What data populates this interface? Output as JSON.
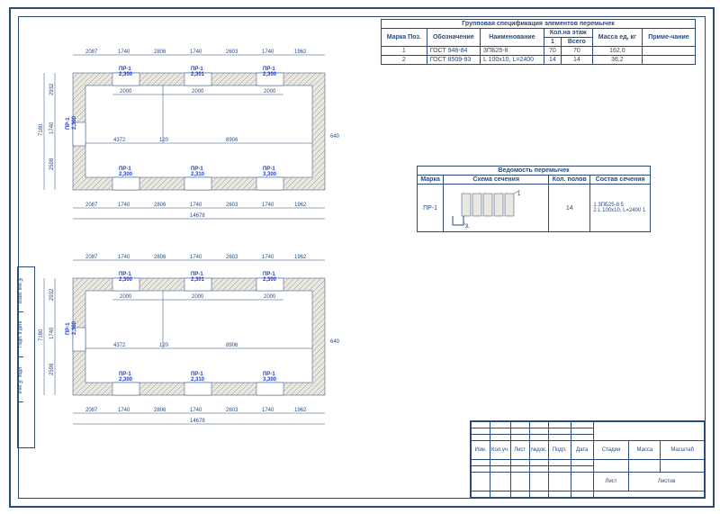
{
  "spec_table": {
    "title": "Групповая спецификация элементов перемычек",
    "headers": [
      "Марка Поз.",
      "Обозначение",
      "Наименование",
      "Кол.на этаж",
      "1",
      "Всего",
      "Масса ед, кг",
      "Приме-чание"
    ],
    "rows": [
      [
        "1",
        "ГОСТ 948-84",
        "3ПБ25-8",
        "70",
        "70",
        "162,0",
        ""
      ],
      [
        "2",
        "ГОСТ 8509-93",
        "L 100x10, L=2400",
        "14",
        "14",
        "36,2",
        ""
      ]
    ]
  },
  "lintel_table": {
    "title": "Ведомость перемычек",
    "headers": [
      "Марка",
      "Схема сечения",
      "Кол. полов",
      "Состав сечения"
    ],
    "mark": "ПР-1",
    "count": "14",
    "composition": [
      "1 3ПБ25-8 5",
      "2 L 100x10, L=2400 1"
    ]
  },
  "plan": {
    "label_pr": "ПР-1",
    "dims_top": [
      "2087",
      "1740",
      "2806",
      "1740",
      "2603",
      "1740",
      "1962"
    ],
    "dims_bottom": [
      "2087",
      "1740",
      "2806",
      "1740",
      "2603",
      "1740",
      "1962"
    ],
    "dims_total": "14678",
    "dims_left": [
      "2932",
      "1740",
      "2598"
    ],
    "dims_left_total": "7180",
    "dims_right": "640",
    "dims_inner_top": [
      "2000",
      "2000",
      "2000"
    ],
    "dims_inner_mid": [
      "4372",
      "120",
      "8906"
    ],
    "vals": [
      "2,300",
      "2,301",
      "2,300",
      "2,300",
      "2,300",
      "2,310",
      "3,300"
    ]
  },
  "stamp_headers": [
    "Изм.",
    "Кол.уч.",
    "Лист",
    "№док.",
    "Подп.",
    "Дата",
    "Стадия",
    "Масса",
    "Масштаб",
    "Лист",
    "Листов"
  ],
  "side_labels": [
    "Инв.№ подл.",
    "Подп. и дата",
    "Взам. инв.№"
  ]
}
